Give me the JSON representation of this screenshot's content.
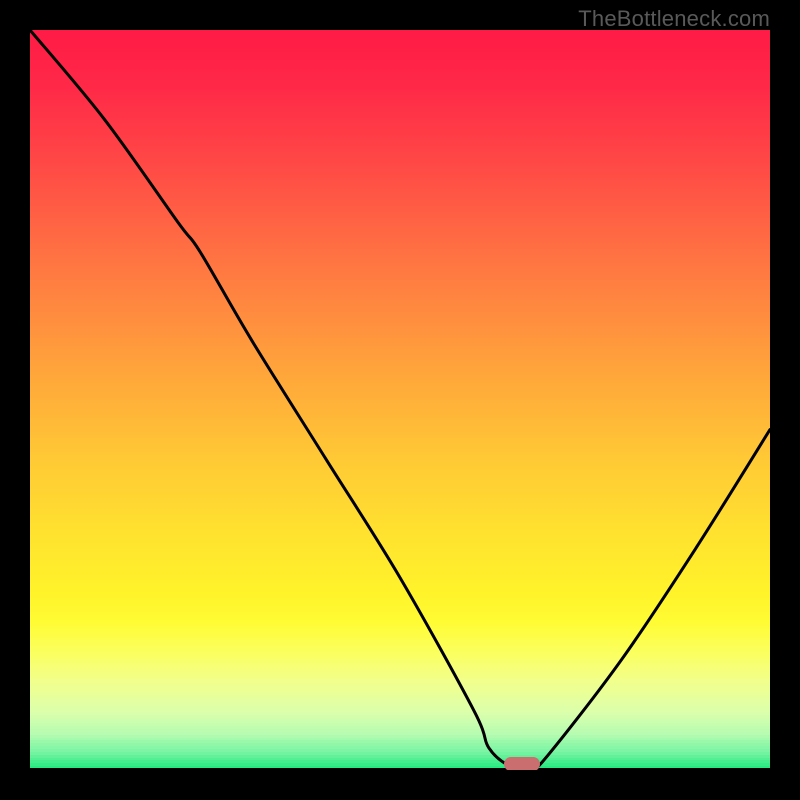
{
  "watermark": "TheBottleneck.com",
  "chart_data": {
    "type": "line",
    "title": "",
    "xlabel": "",
    "ylabel": "",
    "xlim": [
      0,
      100
    ],
    "ylim": [
      0,
      100
    ],
    "grid": false,
    "legend": false,
    "series": [
      {
        "name": "bottleneck-curve",
        "x": [
          0,
          10,
          20,
          23,
          30,
          40,
          50,
          60,
          62,
          65,
          68,
          70,
          80,
          90,
          100
        ],
        "y": [
          100,
          88,
          74,
          70,
          58,
          42,
          26,
          8,
          3,
          0.5,
          0.5,
          2,
          15,
          30,
          46
        ]
      }
    ],
    "marker": {
      "x": 66.5,
      "y": 0.5,
      "color": "#cb6e6f"
    },
    "gradient_stops": [
      {
        "pos": 0.0,
        "color": "#ff1b46"
      },
      {
        "pos": 0.08,
        "color": "#ff2a47"
      },
      {
        "pos": 0.18,
        "color": "#ff4946"
      },
      {
        "pos": 0.28,
        "color": "#ff6a43"
      },
      {
        "pos": 0.38,
        "color": "#ff8b3f"
      },
      {
        "pos": 0.48,
        "color": "#ffab3a"
      },
      {
        "pos": 0.58,
        "color": "#ffc935"
      },
      {
        "pos": 0.68,
        "color": "#ffe22f"
      },
      {
        "pos": 0.76,
        "color": "#fff32a"
      },
      {
        "pos": 0.8,
        "color": "#fffc34"
      },
      {
        "pos": 0.84,
        "color": "#fbff5e"
      },
      {
        "pos": 0.88,
        "color": "#f1ff8c"
      },
      {
        "pos": 0.92,
        "color": "#ddffab"
      },
      {
        "pos": 0.95,
        "color": "#b7fcb1"
      },
      {
        "pos": 0.975,
        "color": "#78f4a3"
      },
      {
        "pos": 1.0,
        "color": "#17e879"
      }
    ]
  }
}
